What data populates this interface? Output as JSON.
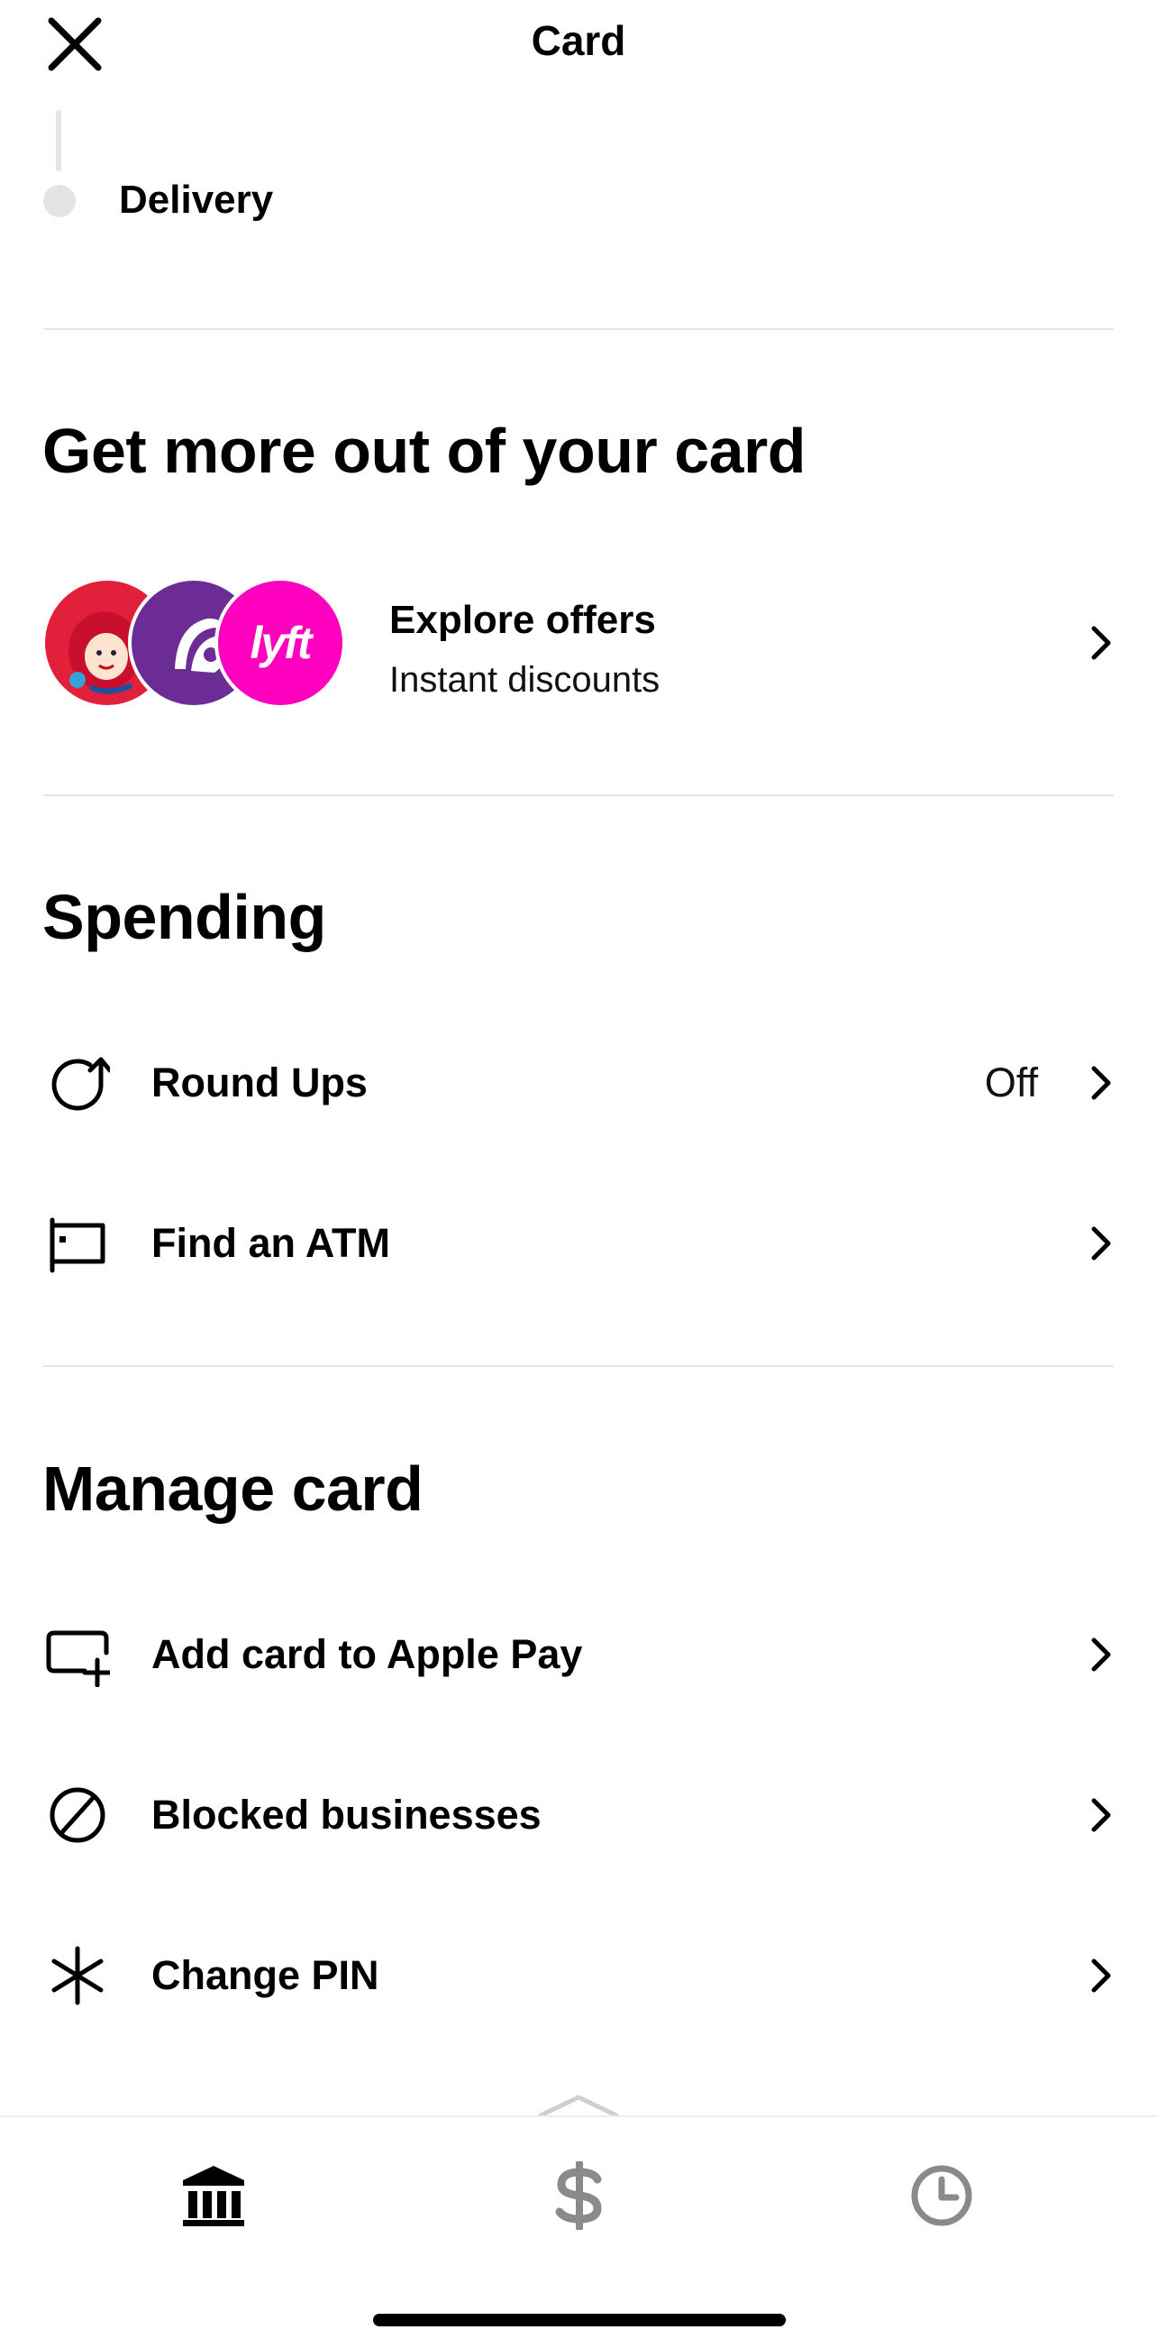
{
  "header": {
    "title": "Card"
  },
  "status_step": {
    "label": "Delivery"
  },
  "offers_section": {
    "title": "Get more out of your card",
    "row": {
      "title": "Explore offers",
      "subtitle": "Instant discounts",
      "lyft_logo_text": "lyft"
    },
    "logos": [
      "wendys-logo",
      "taco-bell-logo",
      "lyft-logo"
    ]
  },
  "spending_section": {
    "title": "Spending",
    "items": [
      {
        "label": "Round Ups",
        "value": "Off",
        "icon": "round-ups-icon"
      },
      {
        "label": "Find an ATM",
        "value": "",
        "icon": "atm-icon"
      }
    ]
  },
  "manage_section": {
    "title": "Manage card",
    "items": [
      {
        "label": "Add card to Apple Pay",
        "icon": "add-card-icon"
      },
      {
        "label": "Blocked businesses",
        "icon": "blocked-icon"
      },
      {
        "label": "Change PIN",
        "icon": "asterisk-icon"
      }
    ]
  },
  "tab_bar": {
    "tabs": [
      {
        "icon": "bank-icon",
        "active": true
      },
      {
        "icon": "dollar-icon",
        "active": false
      },
      {
        "icon": "clock-icon",
        "active": false
      }
    ],
    "active_color": "#000000",
    "inactive_color": "#8a8a8a"
  }
}
